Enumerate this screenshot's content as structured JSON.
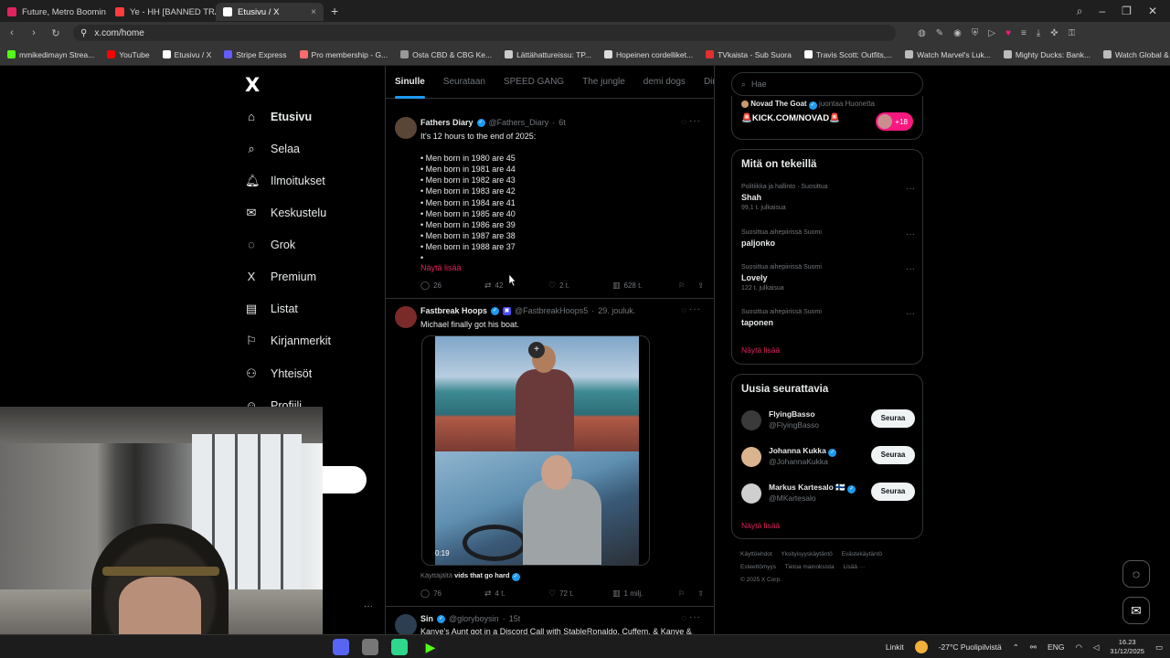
{
  "browser": {
    "tabs": [
      {
        "label": "Future, Metro Boomin",
        "color": "#e0245e",
        "active": false
      },
      {
        "label": "Ye - HH [BANNED TRACK",
        "color": "#ff3b3b",
        "active": false
      },
      {
        "label": "Etusivu / X",
        "color": "#ffffff",
        "active": true
      }
    ],
    "url": "x.com/home",
    "bookmarks": [
      {
        "label": "mmikedimayn Strea...",
        "color": "#53fc18"
      },
      {
        "label": "YouTube",
        "color": "#ff0000"
      },
      {
        "label": "Etusivu / X",
        "color": "#ffffff"
      },
      {
        "label": "Stripe Express",
        "color": "#635bff"
      },
      {
        "label": "Pro membership - G...",
        "color": "#ff6b6b"
      },
      {
        "label": "Osta CBD & CBG Ke...",
        "color": "#999999"
      },
      {
        "label": "Lättähattureissu: TP...",
        "color": "#cccccc"
      },
      {
        "label": "Hopeinen cordelliket...",
        "color": "#dddddd"
      },
      {
        "label": "TVkaista - Sub Suora",
        "color": "#e03030"
      },
      {
        "label": "Travis Scott: Outfits,...",
        "color": "#ffffff"
      },
      {
        "label": "Watch Marvel's Luk...",
        "color": "#bbbbbb"
      },
      {
        "label": "Mighty Ducks: Bank...",
        "color": "#bbbbbb"
      },
      {
        "label": "Watch Global & Loc...",
        "color": "#bbbbbb"
      }
    ]
  },
  "nav": {
    "logo": "X",
    "items": [
      {
        "label": "Etusivu",
        "icon": "home-icon",
        "glyph": "⌂"
      },
      {
        "label": "Selaa",
        "icon": "search-icon",
        "glyph": "⌕"
      },
      {
        "label": "Ilmoitukset",
        "icon": "bell-icon",
        "glyph": "♫"
      },
      {
        "label": "Keskustelu",
        "icon": "mail-icon",
        "glyph": "✉"
      },
      {
        "label": "Grok",
        "icon": "grok-icon",
        "glyph": "◌"
      },
      {
        "label": "Premium",
        "icon": "x-premium-icon",
        "glyph": "X"
      },
      {
        "label": "Listat",
        "icon": "list-icon",
        "glyph": "▤"
      },
      {
        "label": "Kirjanmerkit",
        "icon": "bookmark-icon",
        "glyph": "⚐"
      },
      {
        "label": "Yhteisöt",
        "icon": "communities-icon",
        "glyph": "⚇"
      },
      {
        "label": "Profiili",
        "icon": "profile-icon",
        "glyph": "☺"
      }
    ]
  },
  "feed": {
    "tabs": [
      "Sinulle",
      "Seurataan",
      "SPEED GANG",
      "The jungle",
      "demi dogs",
      "Dima's Dl"
    ],
    "posts": [
      {
        "name": "Fathers Diary",
        "handle": "@Fathers_Diary",
        "time": "6t",
        "text": "It's 12 hours to the end of 2025:\n\n• Men born in 1980 are 45\n• Men born in 1981 are 44\n• Men born in 1982 are 43\n• Men born in 1983 are 42\n• Men born in 1984 are 41\n• Men born in 1985 are 40\n• Men born in 1986 are 39\n• Men born in 1987 are 38\n• Men born in 1988 are 37\n•",
        "show_more": "Näytä lisää",
        "replies": "26",
        "reposts": "42",
        "likes": "2 t.",
        "views": "628 t."
      },
      {
        "name": "Fastbreak Hoops",
        "handle": "@FastbreakHoops5",
        "time": "29. jouluk.",
        "text": "Michael finally got his boat.",
        "video_time": "0:19",
        "context_prefix": "Käyttäjältä",
        "context_name": "vids that go hard",
        "replies": "76",
        "reposts": "4 t.",
        "likes": "72 t.",
        "views": "1 milj."
      },
      {
        "name": "Sin",
        "handle": "@gloryboysin",
        "time": "15t",
        "text": "Kanye's Aunt got in a Discord Call with StableRonaldo, Cuffem, & Kanye &"
      }
    ]
  },
  "right": {
    "search_placeholder": "Hae",
    "live": {
      "host": "Novad The Goat",
      "suffix": "juontaa Huonetta",
      "title": "🚨KICK.COM/NOVAD🚨",
      "count": "+18"
    },
    "trending": {
      "title": "Mitä on tekeillä",
      "items": [
        {
          "meta": "Politiikka ja hallinto · Suosittua",
          "name": "Shah",
          "count": "99,1 t. julkaisua"
        },
        {
          "meta": "Suosittua aihepiirissä Suomi",
          "name": "paljonko",
          "count": ""
        },
        {
          "meta": "Suosittua aihepiirissä Suomi",
          "name": "Lovely",
          "count": "122 t. julkaisua"
        },
        {
          "meta": "Suosittua aihepiirissä Suomi",
          "name": "taponen",
          "count": ""
        }
      ],
      "more": "Näytä lisää"
    },
    "who_to_follow": {
      "title": "Uusia seurattavia",
      "items": [
        {
          "name": "FlyingBasso",
          "handle": "@FlyingBasso",
          "button": "Seuraa",
          "color": "#3a3a3a"
        },
        {
          "name": "Johanna Kukka",
          "handle": "@JohannaKukka",
          "button": "Seuraa",
          "color": "#d9b48f"
        },
        {
          "name": "Markus Kartesalo 🇫🇮",
          "handle": "@MKartesalo",
          "button": "Seuraa",
          "color": "#cfcfcf"
        }
      ],
      "more": "Näytä lisää"
    },
    "footer": [
      "Käyttöehdot",
      "Yksityisyyskäytäntö",
      "Evästekäytäntö",
      "Esteettömyys",
      "Tietoa mainoksista",
      "Lisää ···",
      "© 2025 X Corp."
    ]
  },
  "taskbar": {
    "links": "Linkit",
    "weather": "-27°C Puolipilvistä",
    "lang": "ENG",
    "time": "16.23",
    "date": "31/12/2025"
  }
}
